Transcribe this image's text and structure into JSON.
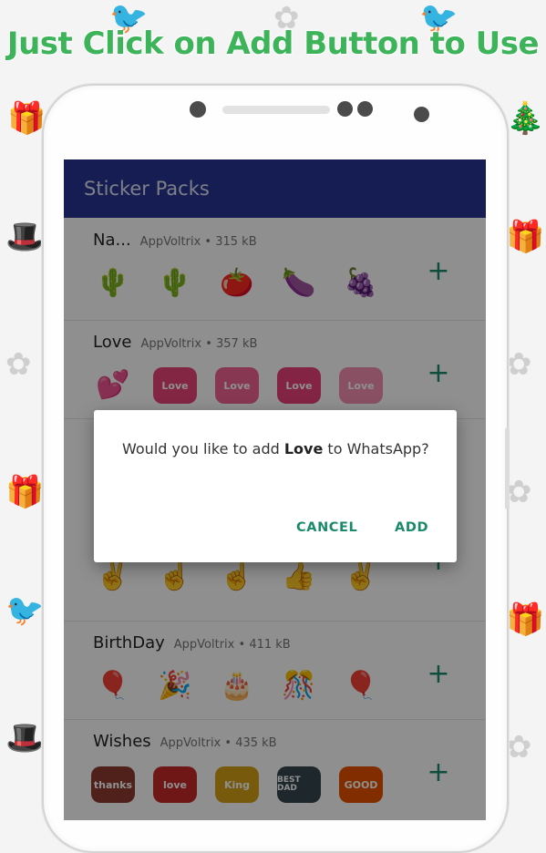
{
  "headline": "Just Click on Add Button to Use",
  "app_bar": {
    "title": "Sticker Packs"
  },
  "packs": [
    {
      "name": "Na...",
      "publisher": "AppVoltrix",
      "size": "315 kB",
      "stickers": [
        "🌵",
        "🌵",
        "🍅",
        "🍆",
        "🍇"
      ]
    },
    {
      "name": "Love",
      "publisher": "AppVoltrix",
      "size": "357 kB",
      "stickers": [
        "💕",
        "Love",
        "Love",
        "Love",
        "Love"
      ]
    },
    {
      "name": "",
      "publisher": "",
      "size": "",
      "stickers": [
        "✌️",
        "☝️",
        "☝️",
        "👍",
        "✌️"
      ]
    },
    {
      "name": "BirthDay",
      "publisher": "AppVoltrix",
      "size": "411 kB",
      "stickers": [
        "🎈",
        "🎉",
        "🎂",
        "🎊",
        "🎈"
      ]
    },
    {
      "name": "Wishes",
      "publisher": "AppVoltrix",
      "size": "435 kB",
      "stickers": [
        "thanks",
        "love",
        "King",
        "BEST DAD",
        "GOOD"
      ]
    }
  ],
  "meta_separator": "•",
  "add_icon": "+",
  "dialog": {
    "message_prefix": "Would you like to add ",
    "message_pack": "Love",
    "message_suffix": " to WhatsApp?",
    "cancel_label": "CANCEL",
    "add_label": "ADD"
  },
  "colors": {
    "headline": "#3db35a",
    "app_bar": "#283593",
    "accent": "#1b8a6b"
  }
}
